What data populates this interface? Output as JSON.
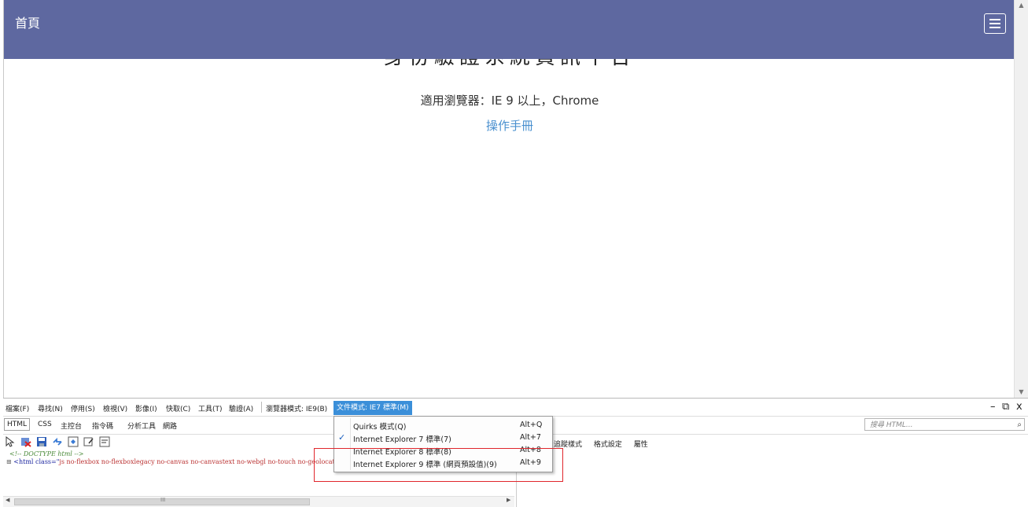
{
  "navbar": {
    "brand": "首頁",
    "menu_icon": "hamburger-icon"
  },
  "page": {
    "title": "身份驗證系統資訊平台",
    "supported_browsers": "適用瀏覽器：IE 9 以上，Chrome",
    "manual_link": "操作手冊"
  },
  "devtools": {
    "menu": {
      "file": "檔案(F)",
      "find": "尋找(N)",
      "disable": "停用(S)",
      "view": "檢視(V)",
      "images": "影像(I)",
      "cache": "快取(C)",
      "tools": "工具(T)",
      "validate": "驗證(A)",
      "browser_mode": "瀏覽器模式: IE9(B)",
      "document_mode": "文件模式: IE7 標準(M)"
    },
    "tabs": {
      "html": "HTML",
      "css": "CSS",
      "console": "主控台",
      "script": "指令碼",
      "profiler": "分析工具",
      "network": "網路"
    },
    "search_placeholder": "搜尋 HTML...",
    "style_tabs": {
      "trace": "追蹤樣式",
      "layout": "格式設定",
      "attributes": "屬性"
    },
    "tree": {
      "doctype": "<!-- DOCTYPE html -->",
      "html_open": "<html class=\"",
      "html_class": "js no-flexbox no-flexboxlegacy no-canvas no-canvastext no-webgl no-touch no-geolocation postmessage no-websqldatabase no-indexeddb no-hashchange"
    },
    "document_mode_menu": [
      {
        "label": "Quirks 模式(Q)",
        "shortcut": "Alt+Q",
        "checked": false
      },
      {
        "label": "Internet Explorer 7 標準(7)",
        "shortcut": "Alt+7",
        "checked": true
      },
      {
        "label": "Internet Explorer 8 標準(8)",
        "shortcut": "Alt+8",
        "checked": false
      },
      {
        "label": "Internet Explorer 9 標準 (網頁預設值)(9)",
        "shortcut": "Alt+9",
        "checked": false
      }
    ],
    "checkmark": "✓",
    "window_controls": {
      "minimize": "–",
      "restore": "⧉",
      "close": "x"
    }
  },
  "colors": {
    "navbar": "#5e68a0",
    "link": "#4a90cf",
    "menu_highlight": "#3b8fd9",
    "annotation": "#e0262c"
  }
}
